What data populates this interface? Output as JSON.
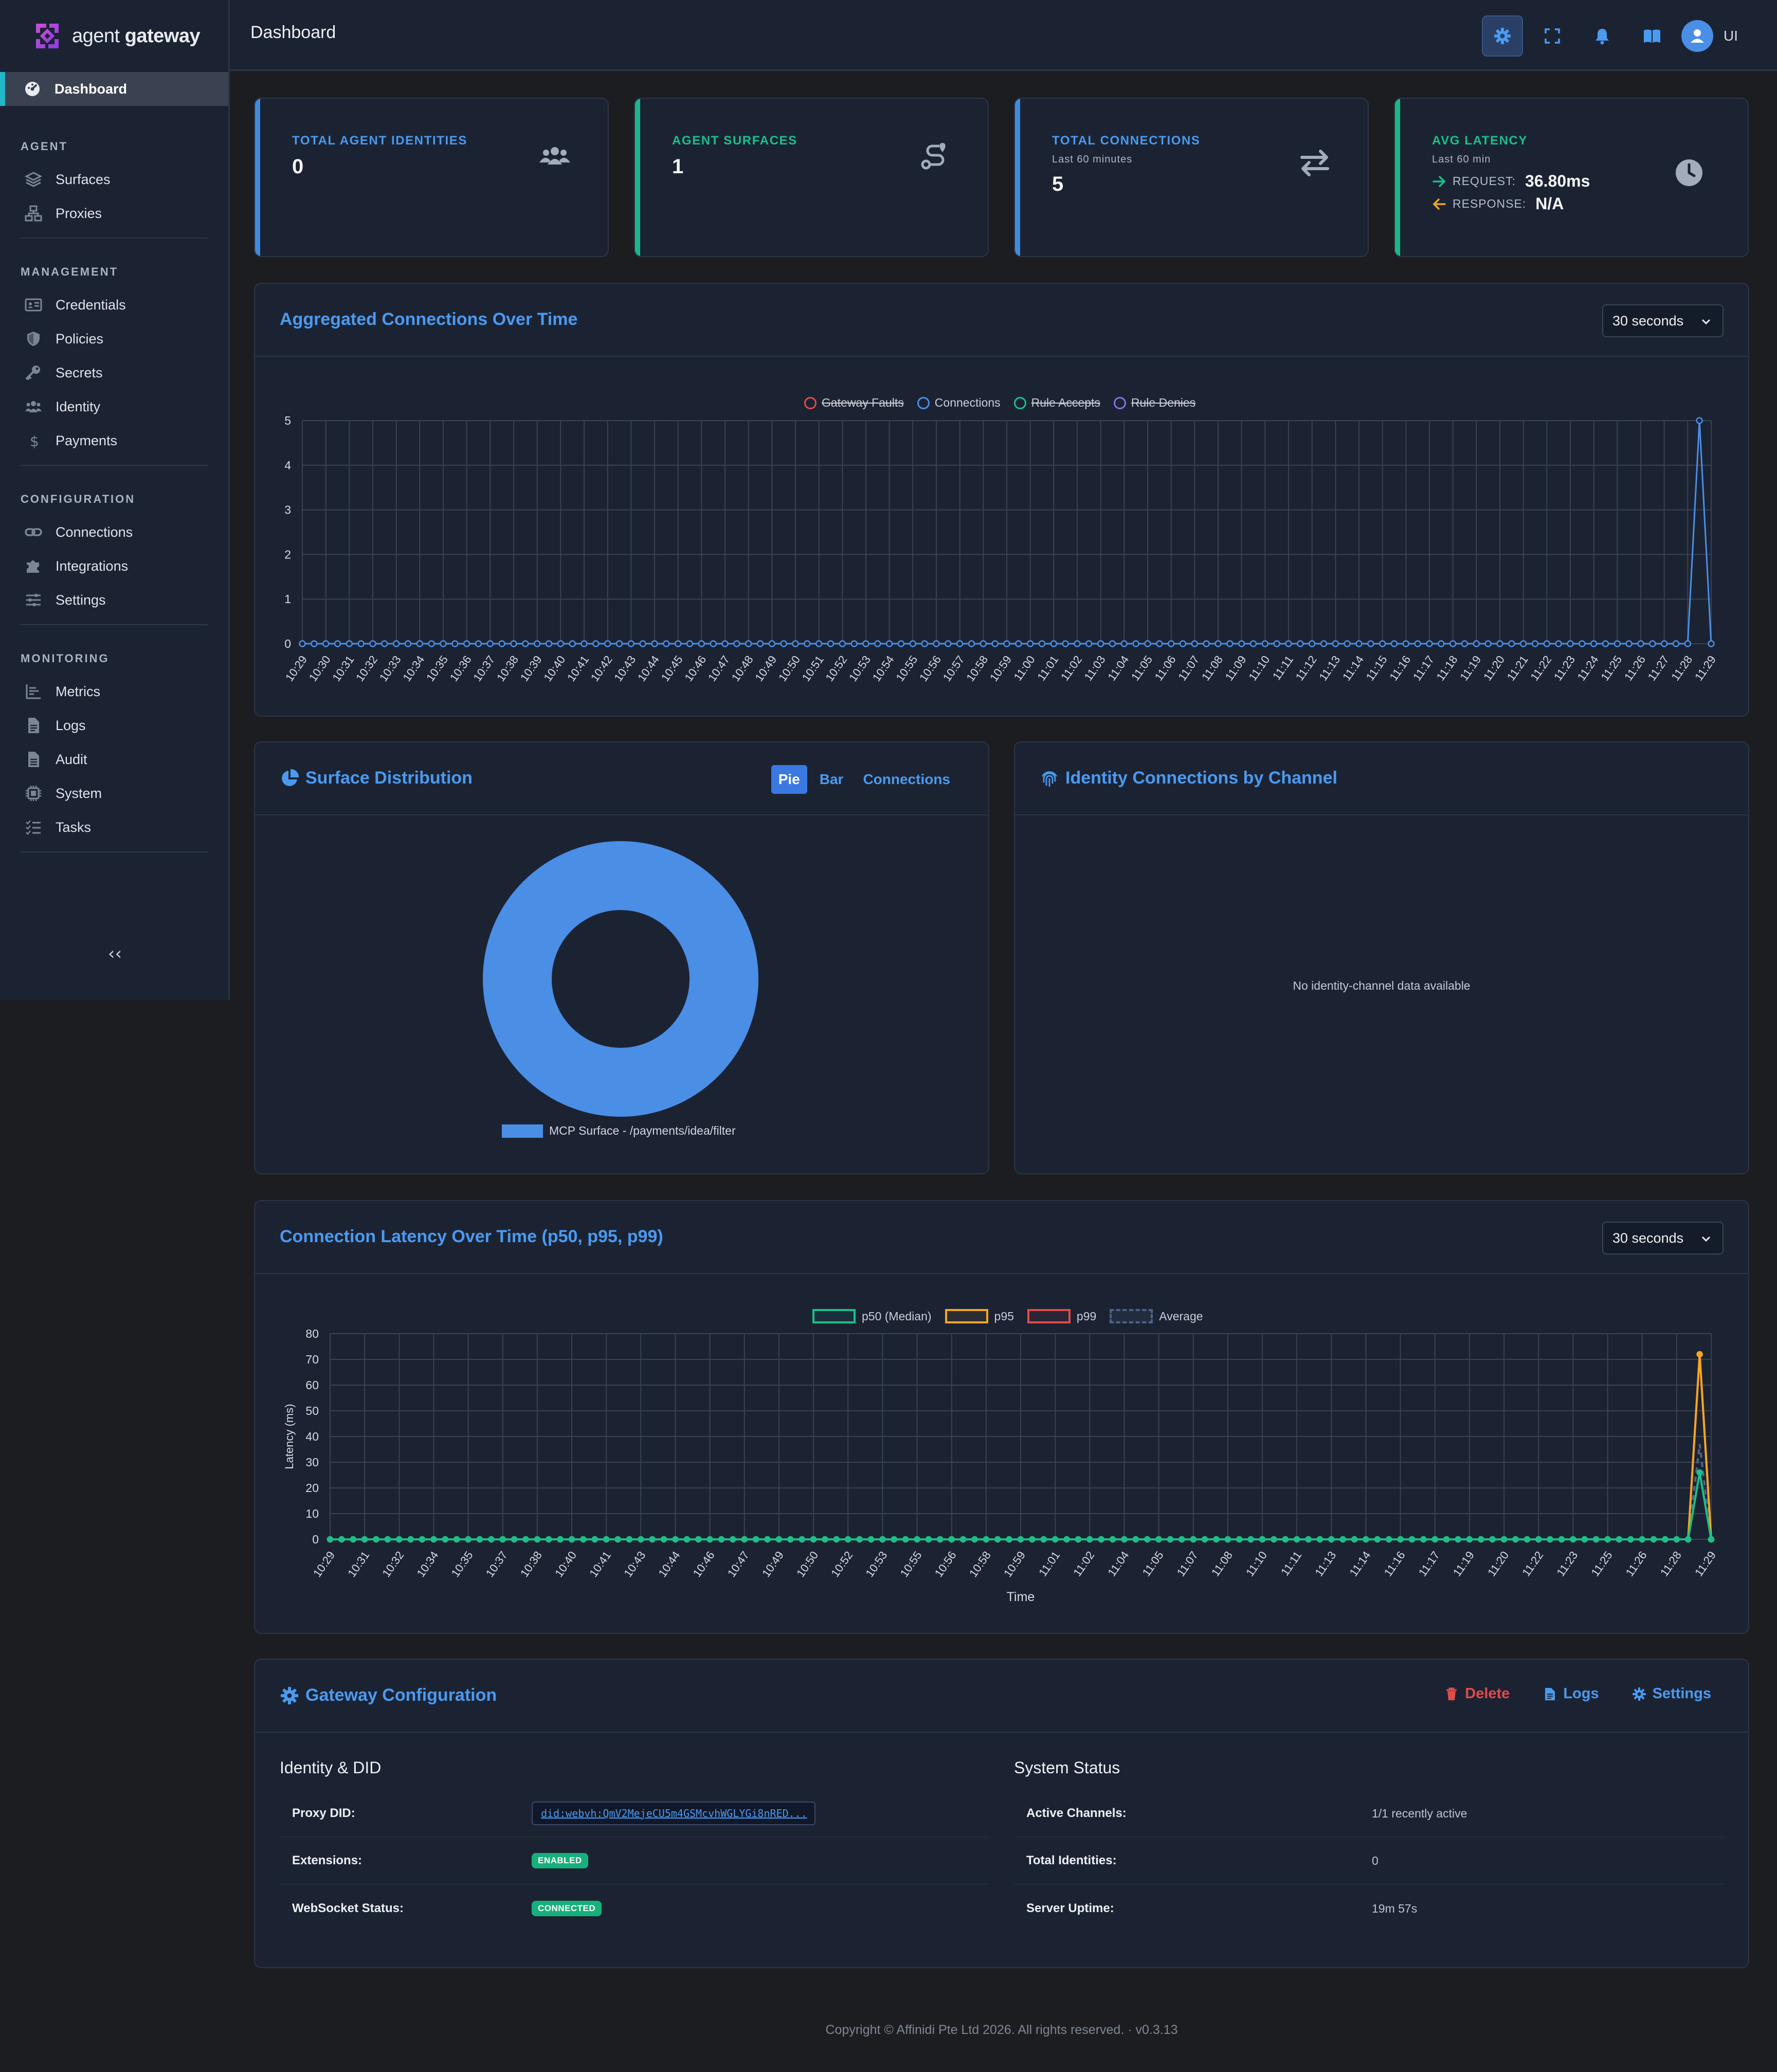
{
  "brand": {
    "name_regular": "agent ",
    "name_bold": "gateway"
  },
  "sidebar": {
    "active": "Dashboard",
    "sections": [
      {
        "title": "AGENT",
        "items": [
          "Surfaces",
          "Proxies"
        ]
      },
      {
        "title": "MANAGEMENT",
        "items": [
          "Credentials",
          "Policies",
          "Secrets",
          "Identity",
          "Payments"
        ]
      },
      {
        "title": "CONFIGURATION",
        "items": [
          "Connections",
          "Integrations",
          "Settings"
        ]
      },
      {
        "title": "MONITORING",
        "items": [
          "Metrics",
          "Logs",
          "Audit",
          "System",
          "Tasks"
        ]
      }
    ],
    "collapse_label": "‹‹"
  },
  "topbar": {
    "title": "Dashboard",
    "user_label": "UI"
  },
  "stats": {
    "identities": {
      "label": "TOTAL AGENT IDENTITIES",
      "value": "0"
    },
    "surfaces": {
      "label": "AGENT SURFACES",
      "value": "1"
    },
    "connections": {
      "label": "TOTAL CONNECTIONS",
      "sub": "Last 60 minutes",
      "value": "5"
    },
    "latency": {
      "label": "AVG LATENCY",
      "sub": "Last 60 min",
      "request_label": "REQUEST:",
      "request_value": "36.80ms",
      "response_label": "RESPONSE:",
      "response_value": "N/A"
    }
  },
  "colors": {
    "accent_blue": "#4a9af0",
    "accent_green": "#19c08a",
    "accent_orange": "#f5a623",
    "accent_red": "#e24b4b"
  },
  "aggregated": {
    "title": "Aggregated Connections Over Time",
    "interval": "30 seconds",
    "legend": [
      {
        "name": "Gateway Faults",
        "color": "#e24b4b",
        "hidden": true
      },
      {
        "name": "Connections",
        "color": "#4a8ee6",
        "hidden": false
      },
      {
        "name": "Rule Accepts",
        "color": "#19c08a",
        "hidden": true
      },
      {
        "name": "Rule Denies",
        "color": "#8b6fe0",
        "hidden": true
      }
    ]
  },
  "surface_dist": {
    "title": "Surface Distribution",
    "tabs": [
      "Pie",
      "Bar",
      "Connections"
    ],
    "legend": "MCP Surface - /payments/idea/filter"
  },
  "identity_channel": {
    "title": "Identity Connections by Channel",
    "empty": "No identity-channel data available"
  },
  "latency_chart": {
    "title": "Connection Latency Over Time (p50, p95, p99)",
    "interval": "30 seconds",
    "legend": [
      {
        "name": "p50 (Median)",
        "color": "#19c08a"
      },
      {
        "name": "p95",
        "color": "#f5a623"
      },
      {
        "name": "p99",
        "color": "#e24b4b"
      },
      {
        "name": "Average",
        "color": "#4f6388"
      }
    ]
  },
  "chart_data": [
    {
      "type": "line",
      "title": "Aggregated Connections Over Time",
      "xlabel": "",
      "ylabel": "",
      "ylim": [
        0,
        5
      ],
      "yticks": [
        0,
        1,
        2,
        3,
        4,
        5
      ],
      "x_labels": [
        "10:29",
        "10:30",
        "10:31",
        "10:32",
        "10:33",
        "10:34",
        "10:35",
        "10:36",
        "10:37",
        "10:38",
        "10:39",
        "10:40",
        "10:41",
        "10:42",
        "10:43",
        "10:44",
        "10:45",
        "10:46",
        "10:47",
        "10:48",
        "10:49",
        "10:50",
        "10:51",
        "10:52",
        "10:53",
        "10:54",
        "10:55",
        "10:56",
        "10:57",
        "10:58",
        "10:59",
        "11:00",
        "11:01",
        "11:02",
        "11:03",
        "11:04",
        "11:05",
        "11:06",
        "11:07",
        "11:08",
        "11:09",
        "11:10",
        "11:11",
        "11:12",
        "11:13",
        "11:14",
        "11:15",
        "11:16",
        "11:17",
        "11:18",
        "11:19",
        "11:20",
        "11:21",
        "11:22",
        "11:23",
        "11:24",
        "11:25",
        "11:26",
        "11:27",
        "11:28",
        "11:29"
      ],
      "point_count": 121,
      "grid": true,
      "legend_position": "top-center",
      "series": [
        {
          "name": "Connections",
          "color": "#4a8ee6",
          "nonzero": [
            {
              "index": 119,
              "value": 5
            }
          ]
        }
      ]
    },
    {
      "type": "pie",
      "title": "Surface Distribution",
      "categories": [
        "MCP Surface - /payments/idea/filter"
      ],
      "values": [
        5
      ],
      "donut": true,
      "legend_position": "bottom"
    },
    {
      "type": "line",
      "title": "Connection Latency Over Time (p50, p95, p99)",
      "xlabel": "Time",
      "ylabel": "Latency (ms)",
      "ylim": [
        0,
        80
      ],
      "yticks": [
        0,
        10,
        20,
        30,
        40,
        50,
        60,
        70,
        80
      ],
      "x_labels": [
        "10:29",
        "10:31",
        "10:32",
        "10:34",
        "10:35",
        "10:37",
        "10:38",
        "10:40",
        "10:41",
        "10:43",
        "10:44",
        "10:46",
        "10:47",
        "10:49",
        "10:50",
        "10:52",
        "10:53",
        "10:55",
        "10:56",
        "10:58",
        "10:59",
        "11:01",
        "11:02",
        "11:04",
        "11:05",
        "11:07",
        "11:08",
        "11:10",
        "11:11",
        "11:13",
        "11:14",
        "11:16",
        "11:17",
        "11:19",
        "11:20",
        "11:22",
        "11:23",
        "11:25",
        "11:26",
        "11:28",
        "11:29"
      ],
      "point_count": 121,
      "grid": true,
      "legend_position": "top-center",
      "series": [
        {
          "name": "p50 (Median)",
          "color": "#19c08a",
          "nonzero": [
            {
              "index": 119,
              "value": 26
            }
          ]
        },
        {
          "name": "p95",
          "color": "#f5a623",
          "nonzero": [
            {
              "index": 119,
              "value": 72
            }
          ]
        },
        {
          "name": "p99",
          "color": "#e24b4b",
          "nonzero": [
            {
              "index": 119,
              "value": 72
            }
          ]
        },
        {
          "name": "Average",
          "color": "#4f6388",
          "dashed": true,
          "nonzero": [
            {
              "index": 119,
              "value": 37
            }
          ]
        }
      ]
    }
  ],
  "gateway": {
    "title": "Gateway Configuration",
    "actions": {
      "delete": "Delete",
      "logs": "Logs",
      "settings": "Settings"
    },
    "identity_heading": "Identity & DID",
    "status_heading": "System Status",
    "proxy_did_label": "Proxy DID:",
    "proxy_did_value": "did:webvh:QmV2MejeCU5m4GSMcvhWGLYGi8nRED...",
    "extensions_label": "Extensions:",
    "extensions_value": "ENABLED",
    "ws_label": "WebSocket Status:",
    "ws_value": "CONNECTED",
    "active_channels_label": "Active Channels:",
    "active_channels_value": "1/1 recently active",
    "total_identities_label": "Total Identities:",
    "total_identities_value": "0",
    "uptime_label": "Server Uptime:",
    "uptime_value": "19m 57s"
  },
  "footer": "Copyright © Affinidi Pte Ltd 2026. All rights reserved. · v0.3.13"
}
